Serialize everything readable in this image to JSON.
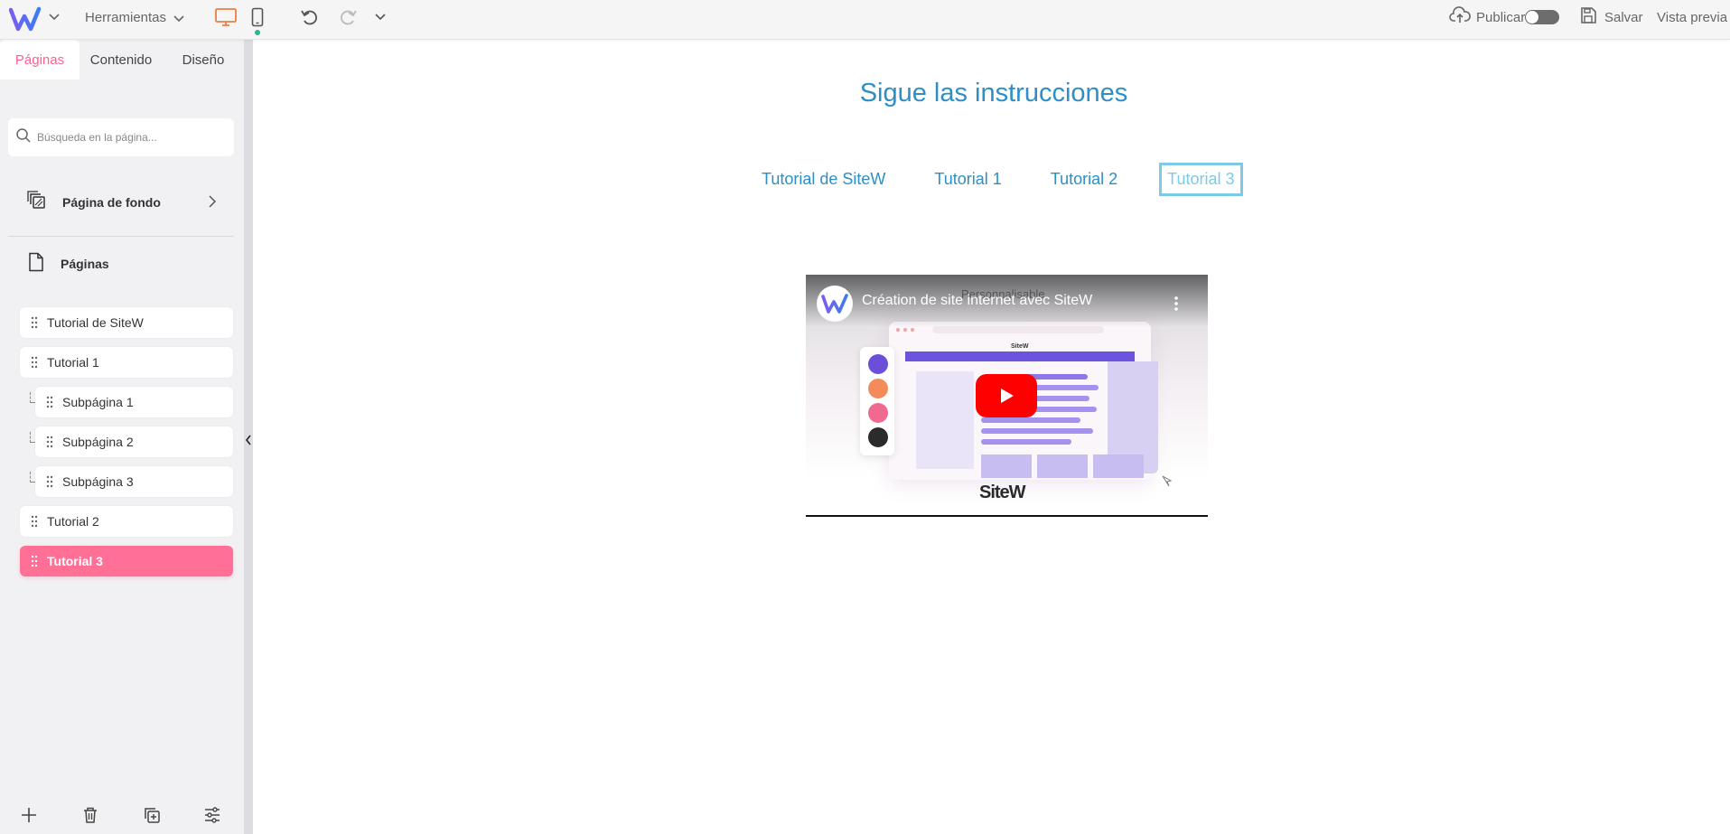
{
  "topbar": {
    "tools_label": "Herramientas",
    "publish_label": "Publicar",
    "save_label": "Salvar",
    "preview_label": "Vista previa",
    "icons": [
      "sitew-logo-icon",
      "chevron-down-icon",
      "desktop-icon",
      "mobile-icon",
      "undo-icon",
      "redo-icon",
      "cloud-upload-icon",
      "save-icon"
    ],
    "publish_toggle_on": false
  },
  "sidebar": {
    "tabs": [
      {
        "label": "Páginas",
        "active": true
      },
      {
        "label": "Contenido",
        "active": false
      },
      {
        "label": "Diseño",
        "active": false
      }
    ],
    "search_placeholder": "Búsqueda en la página...",
    "background_page_label": "Página de fondo",
    "pages_label": "Páginas",
    "pages": [
      {
        "label": "Tutorial de SiteW",
        "level": 0,
        "active": false
      },
      {
        "label": "Tutorial 1",
        "level": 0,
        "active": false
      },
      {
        "label": "Subpágina 1",
        "level": 1,
        "active": false
      },
      {
        "label": "Subpágina 2",
        "level": 1,
        "active": false
      },
      {
        "label": "Subpágina 3",
        "level": 1,
        "active": false
      },
      {
        "label": "Tutorial 2",
        "level": 0,
        "active": false
      },
      {
        "label": "Tutorial 3",
        "level": 0,
        "active": true
      }
    ],
    "bottom_tools": [
      "plus-icon",
      "trash-icon",
      "duplicate-icon",
      "settings-sliders-icon"
    ]
  },
  "canvas": {
    "title": "Sigue las instrucciones",
    "nav": [
      {
        "label": "Tutorial de SiteW",
        "current": false
      },
      {
        "label": "Tutorial 1",
        "current": false
      },
      {
        "label": "Tutorial 2",
        "current": false
      },
      {
        "label": "Tutorial 3",
        "current": true
      }
    ],
    "video": {
      "title": "Création de site internet avec SiteW",
      "overlay_text": "Personnalisable",
      "brand_text": "SiteW",
      "swatch_colors": [
        "#6b4fd8",
        "#f38b5a",
        "#f06a8f",
        "#2b2b2b"
      ]
    }
  },
  "colors": {
    "accent_pink": "#ff5f8f",
    "active_item_bg": "#ff6f96",
    "link_blue": "#2d8fc6",
    "current_nav": "#7ec8e8",
    "desktop_icon": "#f07c45"
  }
}
